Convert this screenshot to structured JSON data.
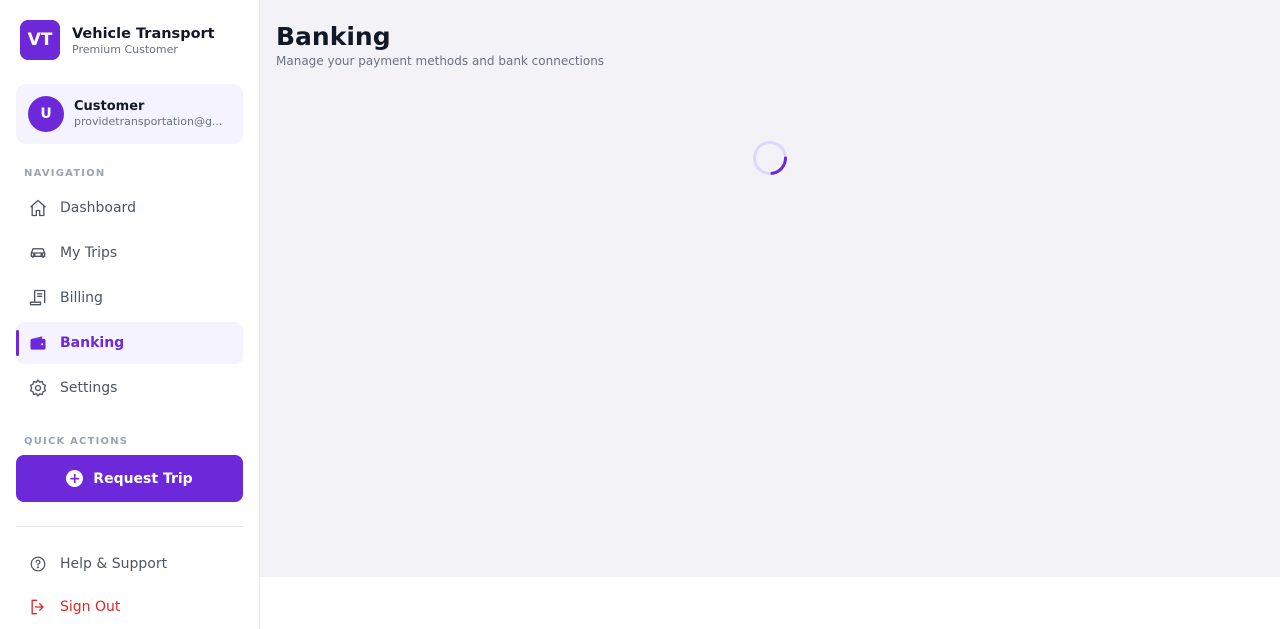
{
  "brand": {
    "logo": "VT",
    "title": "Vehicle Transport",
    "subtitle": "Premium Customer"
  },
  "user": {
    "initial": "U",
    "name": "Customer",
    "email": "providetransportation@g..."
  },
  "nav_section": "NAVIGATION",
  "nav": [
    {
      "label": "Dashboard",
      "icon": "home-icon"
    },
    {
      "label": "My Trips",
      "icon": "car-icon"
    },
    {
      "label": "Billing",
      "icon": "receipt-icon"
    },
    {
      "label": "Banking",
      "icon": "wallet-icon",
      "active": true
    },
    {
      "label": "Settings",
      "icon": "gear-icon"
    }
  ],
  "quick_section": "QUICK ACTIONS",
  "request_button": "Request Trip",
  "footer": {
    "help": "Help & Support",
    "signout": "Sign Out"
  },
  "page": {
    "title": "Banking",
    "subtitle": "Manage your payment methods and bank connections"
  },
  "colors": {
    "accent": "#6d28d9",
    "danger": "#dc2626",
    "content_bg": "#f3f3f7"
  }
}
